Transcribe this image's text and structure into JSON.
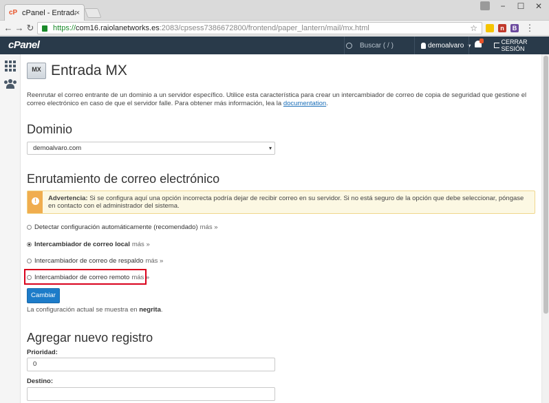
{
  "browser": {
    "tab_title": "cPanel - Entrada MX",
    "tab_close": "×",
    "url_https": "https://",
    "url_host": "com16.raiolanetworks.es",
    "url_path": ":2083/cpsess7386672800/frontend/paper_lantern/mail/mx.html",
    "ext_labels": [
      "n",
      "B"
    ]
  },
  "nav": {
    "logo": "cPanel",
    "search_placeholder": "Buscar ( / )",
    "username": "demoalvaro",
    "logout_label": "CERRAR SESIÓN"
  },
  "page": {
    "icon_label": "MX",
    "title": "Entrada MX",
    "intro_text": "Reenrutar el correo entrante de un dominio a un servidor específico. Utilice esta característica para crear un intercambiador de correo de copia de seguridad que gestione el correo electrónico en caso de que el servidor falle. Para obtener más información, lea la ",
    "intro_link": "documentation",
    "intro_end": "."
  },
  "domain_section": {
    "heading": "Dominio",
    "selected": "demoalvaro.com"
  },
  "routing_section": {
    "heading": "Enrutamiento de correo electrónico",
    "warning_bold": "Advertencia:",
    "warning_text": " Si se configura aquí una opción incorrecta podría dejar de recibir correo en su servidor. Si no está seguro de la opción que debe seleccionar, póngase en contacto con el administrador del sistema.",
    "options": [
      {
        "label": "Detectar configuración automáticamente (recomendado)",
        "more": "más »",
        "checked": false,
        "bold": false
      },
      {
        "label": "Intercambiador de correo local",
        "more": "más »",
        "checked": true,
        "bold": true
      },
      {
        "label": "Intercambiador de correo de respaldo",
        "more": "más »",
        "checked": false,
        "bold": false
      },
      {
        "label": "Intercambiador de correo remoto",
        "more": "más »",
        "checked": false,
        "bold": false
      }
    ],
    "button_label": "Cambiar",
    "note_text": "La configuración actual se muestra en ",
    "note_bold": "negrita",
    "note_end": "."
  },
  "add_section": {
    "heading": "Agregar nuevo registro",
    "priority_label": "Prioridad:",
    "priority_value": "0",
    "destination_label": "Destino:",
    "destination_value": ""
  },
  "colors": {
    "nav_bg": "#293a4a",
    "primary_button": "#1d7cc9",
    "warning": "#f0ad4e",
    "highlight_border": "#d9001b"
  }
}
